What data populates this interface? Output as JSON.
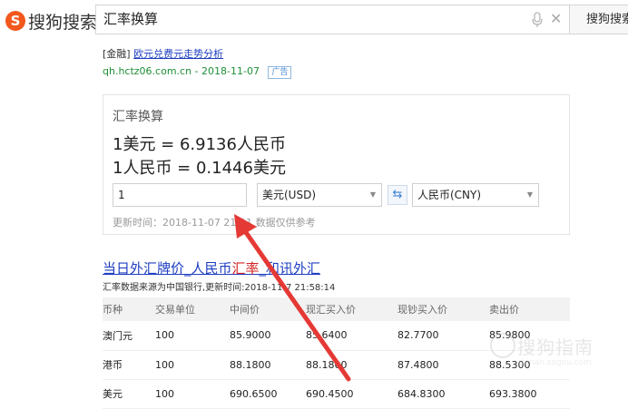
{
  "header": {
    "logo_text": "搜狗搜索",
    "search_value": "汇率换算",
    "search_button": "搜狗搜索"
  },
  "ad": {
    "tag": "[金融]",
    "link_text": "欧元兑费元走势分析",
    "source": "qh.hctz06.com.cn - 2018-11-07",
    "badge": "广告"
  },
  "converter": {
    "title": "汇率换算",
    "rate_line_1": "1美元 = 6.9136人民币",
    "rate_line_2": "1人民币 = 0.1446美元",
    "amount": "1",
    "from_currency": "美元(USD)",
    "to_currency": "人民币(CNY)",
    "update_note": "更新时间：2018-11-07 21:11 数据仅供参考"
  },
  "result": {
    "title_pre": "当日外汇牌价_人民币",
    "title_hl": "汇率",
    "title_post": "_和讯外汇",
    "subtitle": "汇率数据来源为中国银行,更新时间:2018-11-7 21:58:14",
    "columns": [
      "币种",
      "交易单位",
      "中间价",
      "现汇买入价",
      "现钞买入价",
      "卖出价"
    ],
    "rows": [
      [
        "澳门元",
        "100",
        "85.9000",
        "85.6400",
        "82.7700",
        "85.9800"
      ],
      [
        "港币",
        "100",
        "88.1800",
        "88.1800",
        "87.4800",
        "88.5300"
      ],
      [
        "美元",
        "100",
        "690.6500",
        "690.4500",
        "684.8300",
        "693.3800"
      ]
    ]
  },
  "watermark": {
    "text": "搜狗指南",
    "url": "zhinan.sogou.com"
  },
  "colors": {
    "brand": "#f2581d",
    "link": "#1e3ec2",
    "highlight": "#d52222",
    "arrow": "#e53935"
  }
}
